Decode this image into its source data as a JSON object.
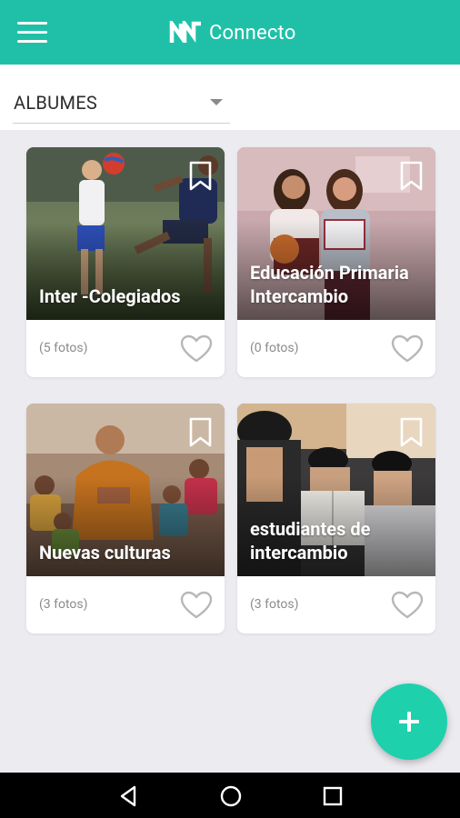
{
  "app": {
    "name": "Connecto",
    "accent_color": "#20c0a8",
    "fab_color": "#1fd0ad"
  },
  "toolbar": {
    "menu_icon": "hamburger-menu-icon",
    "logo_icon": "connecto-logo-icon"
  },
  "selector": {
    "label": "ALBUMES",
    "icon": "dropdown-caret-icon"
  },
  "albums": [
    {
      "title": "Inter -Colegiados",
      "count": "(5 fotos)",
      "bookmark_icon": "bookmark-icon",
      "favorite_icon": "heart-icon"
    },
    {
      "title": "Educación Primaria Intercambio",
      "count": "(0 fotos)",
      "bookmark_icon": "bookmark-icon",
      "favorite_icon": "heart-icon"
    },
    {
      "title": "Nuevas culturas",
      "count": "(3 fotos)",
      "bookmark_icon": "bookmark-icon",
      "favorite_icon": "heart-icon"
    },
    {
      "title": "estudiantes de intercambio",
      "count": "(3 fotos)",
      "bookmark_icon": "bookmark-icon",
      "favorite_icon": "heart-icon"
    }
  ],
  "fab": {
    "icon": "plus-icon"
  },
  "navigation": {
    "back_icon": "back-triangle-icon",
    "home_icon": "home-circle-icon",
    "recents_icon": "recents-square-icon"
  }
}
